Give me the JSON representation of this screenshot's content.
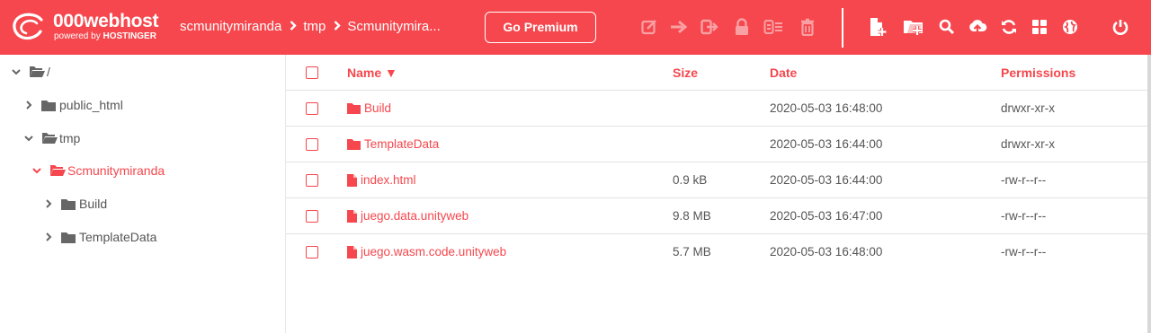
{
  "brand": {
    "title": "000webhost",
    "subtitle_prefix": "powered by",
    "subtitle_brand": "HOSTINGER",
    "color": "#f5474d"
  },
  "breadcrumb": {
    "items": [
      "scmunitymiranda",
      "tmp",
      "Scmunitymira..."
    ],
    "separator_icon": "chevron-right-icon"
  },
  "premium_button": "Go Premium",
  "toolbar": {
    "disabled_icons": [
      "edit-icon",
      "move-icon",
      "rename-icon",
      "lock-icon",
      "extract-icon",
      "trash-icon"
    ],
    "enabled_icons": [
      "new-file-icon",
      "new-folder-icon",
      "search-icon",
      "upload-icon",
      "refresh-icon",
      "view-grid-icon",
      "globe-icon",
      "power-icon"
    ]
  },
  "tree": [
    {
      "label": "/",
      "level": 0,
      "expanded": true,
      "active": false
    },
    {
      "label": "public_html",
      "level": 1,
      "expanded": false,
      "active": false
    },
    {
      "label": "tmp",
      "level": 1,
      "expanded": true,
      "active": false
    },
    {
      "label": "Scmunitymiranda",
      "level": 2,
      "expanded": true,
      "active": true
    },
    {
      "label": "Build",
      "level": 3,
      "expanded": false,
      "active": false
    },
    {
      "label": "TemplateData",
      "level": 3,
      "expanded": false,
      "active": false
    }
  ],
  "table": {
    "headers": {
      "name": "Name ▼",
      "size": "Size",
      "date": "Date",
      "permissions": "Permissions"
    },
    "rows": [
      {
        "type": "folder",
        "name": "Build",
        "size": "",
        "date": "2020-05-03 16:48:00",
        "permissions": "drwxr-xr-x"
      },
      {
        "type": "folder",
        "name": "TemplateData",
        "size": "",
        "date": "2020-05-03 16:44:00",
        "permissions": "drwxr-xr-x"
      },
      {
        "type": "file",
        "name": "index.html",
        "size": "0.9 kB",
        "date": "2020-05-03 16:44:00",
        "permissions": "-rw-r--r--"
      },
      {
        "type": "file",
        "name": "juego.data.unityweb",
        "size": "9.8 MB",
        "date": "2020-05-03 16:47:00",
        "permissions": "-rw-r--r--"
      },
      {
        "type": "file",
        "name": "juego.wasm.code.unityweb",
        "size": "5.7 MB",
        "date": "2020-05-03 16:48:00",
        "permissions": "-rw-r--r--"
      }
    ]
  },
  "colors": {
    "accent": "#f5474d",
    "disabled_icon": "#f8a0a4",
    "text": "#555555"
  }
}
